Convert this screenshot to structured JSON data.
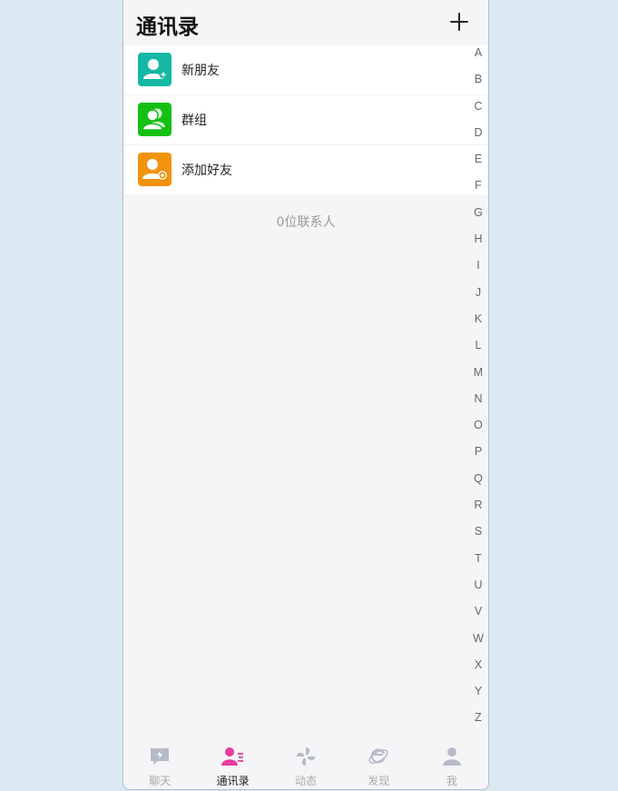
{
  "header": {
    "title": "通讯录"
  },
  "menu": [
    {
      "label": "新朋友",
      "icon": "new-friend-icon",
      "color": "#15b8a3"
    },
    {
      "label": "群组",
      "icon": "group-icon",
      "color": "#13c013"
    },
    {
      "label": "添加好友",
      "icon": "add-friend-icon",
      "color": "#f3920d"
    }
  ],
  "contact_count": "0位联系人",
  "alphabet": [
    "A",
    "B",
    "C",
    "D",
    "E",
    "F",
    "G",
    "H",
    "I",
    "J",
    "K",
    "L",
    "M",
    "N",
    "O",
    "P",
    "Q",
    "R",
    "S",
    "T",
    "U",
    "V",
    "W",
    "X",
    "Y",
    "Z"
  ],
  "tabs": [
    {
      "label": "聊天",
      "icon": "chat-icon",
      "active": false
    },
    {
      "label": "通讯录",
      "icon": "contacts-icon",
      "active": true
    },
    {
      "label": "动态",
      "icon": "pinwheel-icon",
      "active": false
    },
    {
      "label": "发现",
      "icon": "explore-icon",
      "active": false
    },
    {
      "label": "我",
      "icon": "profile-icon",
      "active": false
    }
  ],
  "colors": {
    "active_tab": "#e93c9d",
    "inactive_tab": "#b5bcc8"
  }
}
